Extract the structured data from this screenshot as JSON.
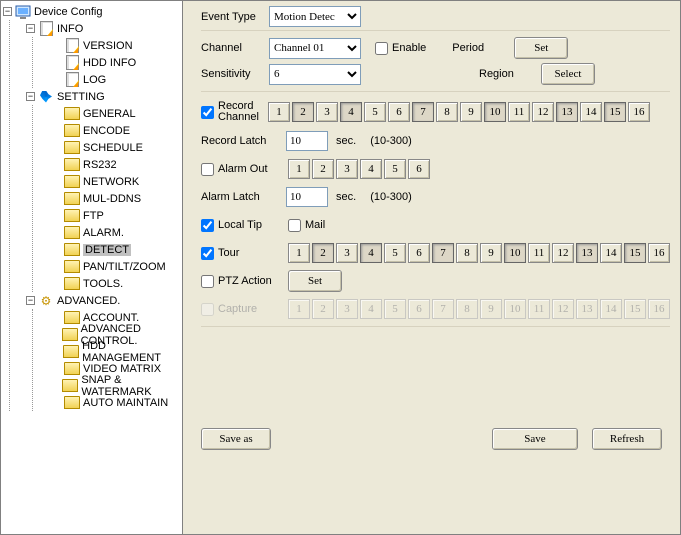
{
  "tree": {
    "title": "Device Config",
    "nodes": [
      {
        "name": "INFO",
        "icon": "doc",
        "expanded": true,
        "children": [
          {
            "name": "VERSION",
            "icon": "doc"
          },
          {
            "name": "HDD INFO",
            "icon": "doc"
          },
          {
            "name": "LOG",
            "icon": "doc"
          }
        ]
      },
      {
        "name": "SETTING",
        "icon": "tools",
        "expanded": true,
        "children": [
          {
            "name": "GENERAL",
            "icon": "folder"
          },
          {
            "name": "ENCODE",
            "icon": "folder"
          },
          {
            "name": "SCHEDULE",
            "icon": "folder"
          },
          {
            "name": "RS232",
            "icon": "folder"
          },
          {
            "name": "NETWORK",
            "icon": "folder"
          },
          {
            "name": "MUL-DDNS",
            "icon": "folder"
          },
          {
            "name": "FTP",
            "icon": "folder"
          },
          {
            "name": "ALARM.",
            "icon": "folder"
          },
          {
            "name": "DETECT",
            "icon": "folder",
            "selected": true
          },
          {
            "name": "PAN/TILT/ZOOM",
            "icon": "folder"
          },
          {
            "name": "TOOLS.",
            "icon": "folder"
          }
        ]
      },
      {
        "name": "ADVANCED.",
        "icon": "gears",
        "expanded": true,
        "children": [
          {
            "name": "ACCOUNT.",
            "icon": "folder"
          },
          {
            "name": "ADVANCED CONTROL.",
            "icon": "folder"
          },
          {
            "name": "HDD MANAGEMENT",
            "icon": "folder"
          },
          {
            "name": "VIDEO MATRIX",
            "icon": "folder"
          },
          {
            "name": "SNAP & WATERMARK",
            "icon": "folder"
          },
          {
            "name": "AUTO MAINTAIN",
            "icon": "folder"
          }
        ]
      }
    ]
  },
  "form": {
    "eventType": {
      "label": "Event Type",
      "value": "Motion Detec"
    },
    "channel": {
      "label": "Channel",
      "value": "Channel  01"
    },
    "enable": {
      "label": "Enable",
      "checked": false
    },
    "period": {
      "label": "Period",
      "button": "Set"
    },
    "sensitivity": {
      "label": "Sensitivity",
      "value": "6"
    },
    "region": {
      "label": "Region",
      "button": "Select"
    },
    "recordChannel": {
      "label": "Record Channel",
      "checked": true,
      "count": 16,
      "pressed": [
        2,
        4,
        7,
        10,
        13,
        15
      ]
    },
    "recordLatch": {
      "label": "Record Latch",
      "value": "10",
      "unit": "sec.",
      "range": "(10-300)"
    },
    "alarmOut": {
      "label": "Alarm Out",
      "checked": false,
      "count": 6,
      "pressed": []
    },
    "alarmLatch": {
      "label": "Alarm Latch",
      "value": "10",
      "unit": "sec.",
      "range": "(10-300)"
    },
    "localTip": {
      "label": "Local Tip",
      "checked": true
    },
    "mail": {
      "label": "Mail",
      "checked": false
    },
    "tour": {
      "label": "Tour",
      "checked": true,
      "count": 16,
      "pressed": [
        2,
        4,
        7,
        10,
        13,
        15
      ]
    },
    "ptzAction": {
      "label": "PTZ Action",
      "checked": false,
      "button": "Set"
    },
    "capture": {
      "label": "Capture",
      "checked": false,
      "count": 16,
      "disabled": true
    },
    "buttons": {
      "saveAs": "Save as",
      "save": "Save",
      "refresh": "Refresh"
    }
  }
}
